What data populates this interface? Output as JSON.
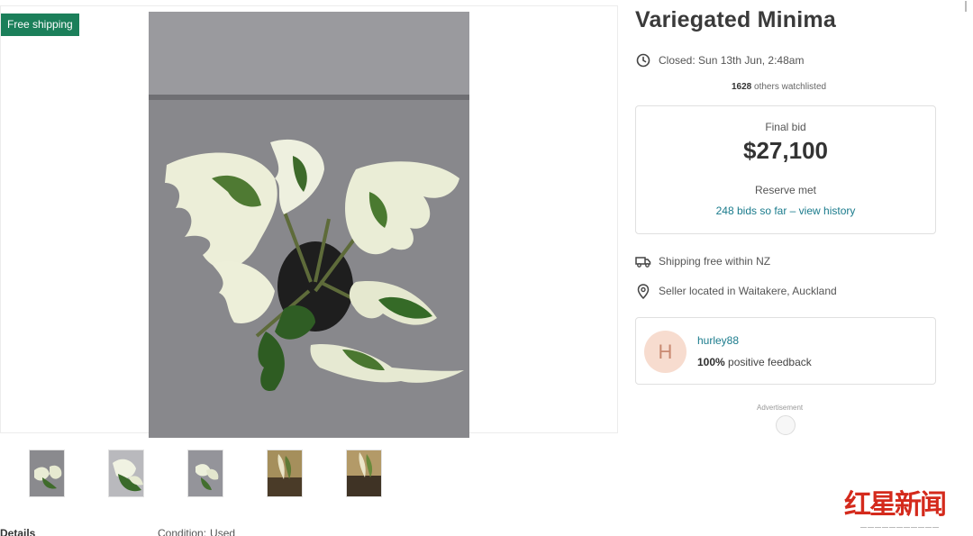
{
  "badge": {
    "free_shipping": "Free shipping"
  },
  "listing": {
    "title": "Variegated Minima",
    "closed": "Closed: Sun 13th Jun, 2:48am",
    "watchlist_count": "1628",
    "watchlist_suffix": " others watchlisted"
  },
  "bid": {
    "label": "Final bid",
    "amount": "$27,100",
    "reserve": "Reserve met",
    "history_link": "248 bids so far – view history"
  },
  "shipping": {
    "text": "Shipping free within NZ"
  },
  "location": {
    "text": "Seller located in Waitakere, Auckland"
  },
  "seller": {
    "initial": "H",
    "name": "hurley88",
    "feedback_pct": "100%",
    "feedback_suffix": " positive feedback"
  },
  "ad": {
    "label": "Advertisement"
  },
  "footer": {
    "details": "Details",
    "condition_label": "Condition:",
    "condition_value": "Used"
  },
  "watermark": {
    "text": "红星新闻"
  },
  "icons": {
    "clock": "clock-icon",
    "truck": "truck-icon",
    "pin": "location-pin-icon"
  },
  "colors": {
    "badge_green": "#1b7f5a",
    "link_teal": "#1a7b8c",
    "avatar_bg": "#f7dccf",
    "watermark_red": "#d42a1c"
  }
}
